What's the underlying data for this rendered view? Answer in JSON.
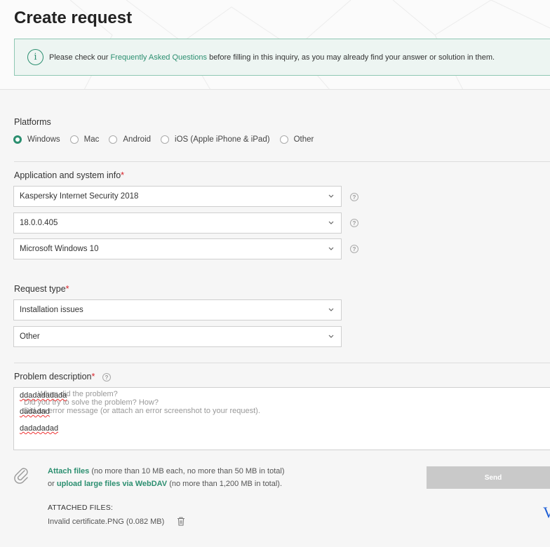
{
  "header": {
    "title": "Create request",
    "notice": {
      "before": "Please check our ",
      "link": "Frequently Asked Questions",
      "after": " before filling in this inquiry, as you may already find your answer or solution in them."
    }
  },
  "platforms": {
    "label": "Platforms",
    "options": [
      "Windows",
      "Mac",
      "Android",
      "iOS (Apple iPhone & iPad)",
      "Other"
    ],
    "selected": "Windows"
  },
  "app_info": {
    "label": "Application and system info",
    "product": "Kaspersky Internet Security 2018",
    "version": "18.0.0.405",
    "os": "Microsoft Windows 10"
  },
  "request_type": {
    "label": "Request type",
    "category": "Installation issues",
    "subcategory": "Other"
  },
  "problem": {
    "label": "Problem description",
    "placeholder_lines": [
      "When did the problem?",
      "Did you try to solve the problem? How?",
      "Did an error message (or attach an error screenshot to your request)."
    ],
    "typed_lines": [
      "ddadadadada",
      "dadadad",
      "dadadadad"
    ]
  },
  "attach": {
    "link1": "Attach files",
    "text1": " (no more than 10 MB each, no more than 50 MB in total)",
    "prefix2": "or ",
    "link2": "upload large files via WebDAV",
    "text2": " (no more than 1,200 MB in total)."
  },
  "send_label": "Send",
  "attached": {
    "heading": "ATTACHED FILES:",
    "file": "Invalid certificate.PNG (0.082 MB)"
  },
  "edge_glyph": "V"
}
